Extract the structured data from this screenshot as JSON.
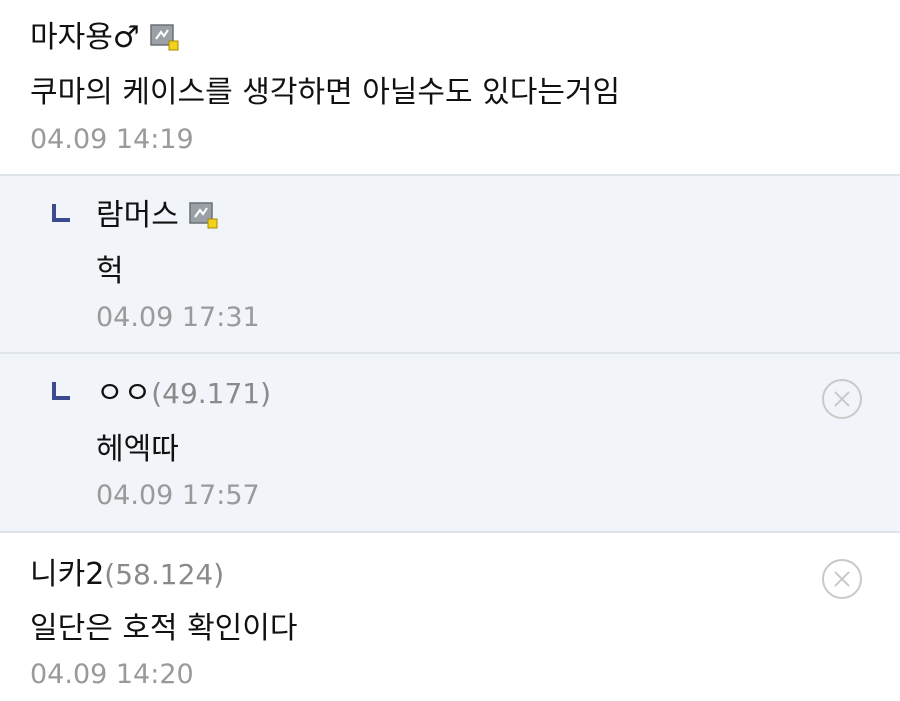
{
  "comments": [
    {
      "author": "마자용♂",
      "ip": "",
      "text": "쿠마의 케이스를 생각하면 아닐수도 있다는거임",
      "time": "04.09 14:19",
      "badge_icon": "fixed-nick-badge-icon"
    },
    {
      "author": "람머스",
      "ip": "",
      "text": "헉",
      "time": "04.09 17:31",
      "badge_icon": "fixed-nick-badge-icon"
    },
    {
      "author": "ㅇㅇ",
      "ip": "(49.171)",
      "text": "헤엑따",
      "time": "04.09 17:57"
    },
    {
      "author": "니카2",
      "ip": "(58.124)",
      "text": "일단은 호적 확인이다",
      "time": "04.09 14:20"
    }
  ],
  "colors": {
    "reply_bg": "#f1f4f9",
    "divider": "#dfe3ea",
    "reply_mark": "#3b4a8c",
    "time_text": "#9a9a9a"
  }
}
